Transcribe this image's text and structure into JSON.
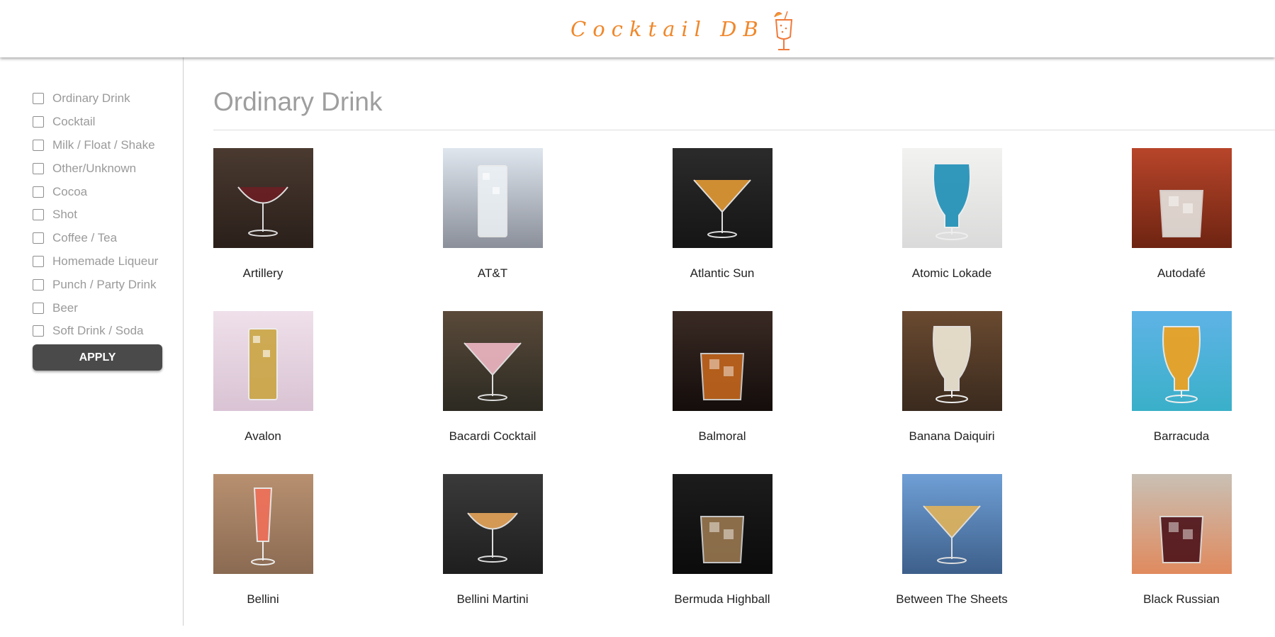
{
  "header": {
    "logo_text": "Cocktail DB"
  },
  "sidebar": {
    "filters": [
      {
        "label": "Ordinary Drink",
        "checked": false
      },
      {
        "label": "Cocktail",
        "checked": false
      },
      {
        "label": "Milk / Float / Shake",
        "checked": false
      },
      {
        "label": "Other/Unknown",
        "checked": false
      },
      {
        "label": "Cocoa",
        "checked": false
      },
      {
        "label": "Shot",
        "checked": false
      },
      {
        "label": "Coffee / Tea",
        "checked": false
      },
      {
        "label": "Homemade Liqueur",
        "checked": false
      },
      {
        "label": "Punch / Party Drink",
        "checked": false
      },
      {
        "label": "Beer",
        "checked": false
      },
      {
        "label": "Soft Drink / Soda",
        "checked": false
      }
    ],
    "apply_label": "APPLY"
  },
  "main": {
    "title": "Ordinary Drink",
    "drinks": [
      {
        "name": "Artillery",
        "glass": "coupe",
        "bg": [
          "#4a3a30",
          "#2a1f1a"
        ],
        "liquid": "#6b1f24"
      },
      {
        "name": "AT&T",
        "glass": "highball",
        "bg": [
          "#dfe6ee",
          "#8a8f99"
        ],
        "liquid": "#eef3f7"
      },
      {
        "name": "Atlantic Sun",
        "glass": "martini",
        "bg": [
          "#2b2b2b",
          "#151515"
        ],
        "liquid": "#e39a35"
      },
      {
        "name": "Atomic Lokade",
        "glass": "hurricane",
        "bg": [
          "#f2f2f0",
          "#dadada"
        ],
        "liquid": "#1d8fb7"
      },
      {
        "name": "Autodafé",
        "glass": "rocks",
        "bg": [
          "#b8452a",
          "#6e2412"
        ],
        "liquid": "#e8e8e4"
      },
      {
        "name": "Avalon",
        "glass": "highball",
        "bg": [
          "#efe0ea",
          "#d9c3d4"
        ],
        "liquid": "#c9a33a"
      },
      {
        "name": "Bacardi Cocktail",
        "glass": "martini",
        "bg": [
          "#5a4a3a",
          "#2c2a22"
        ],
        "liquid": "#efb8c4"
      },
      {
        "name": "Balmoral",
        "glass": "rocks",
        "bg": [
          "#3a2a24",
          "#140d0b"
        ],
        "liquid": "#c8681e"
      },
      {
        "name": "Banana Daiquiri",
        "glass": "hurricane",
        "bg": [
          "#6a4a30",
          "#3a2a1e"
        ],
        "liquid": "#f1ead8"
      },
      {
        "name": "Barracuda",
        "glass": "hurricane",
        "bg": [
          "#5fb3e6",
          "#3ab0c9"
        ],
        "liquid": "#f2a21c"
      },
      {
        "name": "Bellini",
        "glass": "flute",
        "bg": [
          "#b89070",
          "#8a6a52"
        ],
        "liquid": "#f0705a"
      },
      {
        "name": "Bellini Martini",
        "glass": "coupe",
        "bg": [
          "#3a3a3a",
          "#1e1e1e"
        ],
        "liquid": "#e6a55a"
      },
      {
        "name": "Bermuda Highball",
        "glass": "rocks",
        "bg": [
          "#1c1c1c",
          "#0b0b0b"
        ],
        "liquid": "#9c7a52"
      },
      {
        "name": "Between The Sheets",
        "glass": "martini",
        "bg": [
          "#6f9fd6",
          "#3d5f8a"
        ],
        "liquid": "#e0b35a"
      },
      {
        "name": "Black Russian",
        "glass": "rocks",
        "bg": [
          "#c9c0b4",
          "#e08a5e"
        ],
        "liquid": "#4a1018"
      }
    ]
  }
}
